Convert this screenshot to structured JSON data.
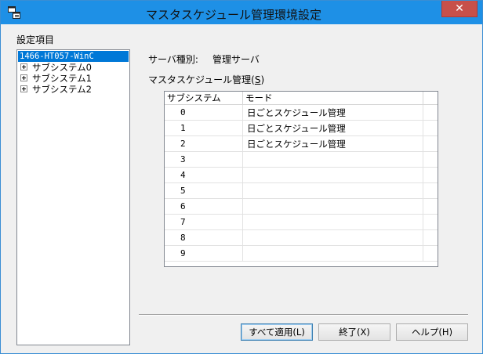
{
  "window": {
    "title": "マスタスケジュール管理環境設定",
    "close_glyph": "✕"
  },
  "left_panel": {
    "group_label": "設定項目",
    "tree": {
      "root": "1466-HT057-WinC",
      "items": [
        "サブシステム0",
        "サブシステム1",
        "サブシステム2"
      ]
    }
  },
  "server": {
    "type_label": "サーバ種別:",
    "type_value": "管理サーバ"
  },
  "schedule": {
    "label": "マスタスケジュール管理(",
    "label_mnemonic": "S",
    "label_end": ")",
    "columns": [
      "サブシステム",
      "モード"
    ],
    "rows": [
      {
        "num": "0",
        "mode": "日ごとスケジュール管理"
      },
      {
        "num": "1",
        "mode": "日ごとスケジュール管理"
      },
      {
        "num": "2",
        "mode": "日ごとスケジュール管理"
      },
      {
        "num": "3",
        "mode": ""
      },
      {
        "num": "4",
        "mode": ""
      },
      {
        "num": "5",
        "mode": ""
      },
      {
        "num": "6",
        "mode": ""
      },
      {
        "num": "7",
        "mode": ""
      },
      {
        "num": "8",
        "mode": ""
      },
      {
        "num": "9",
        "mode": ""
      }
    ]
  },
  "buttons": {
    "apply_all": "すべて適用(L)",
    "exit": "終了(X)",
    "help": "ヘルプ(H)"
  },
  "colors": {
    "titlebar": "#1e90e6",
    "close": "#c7504a",
    "selection": "#0078d7"
  },
  "icons": {
    "app": "window-grid-icon",
    "close": "close-icon",
    "expander": "plus-box-icon"
  }
}
